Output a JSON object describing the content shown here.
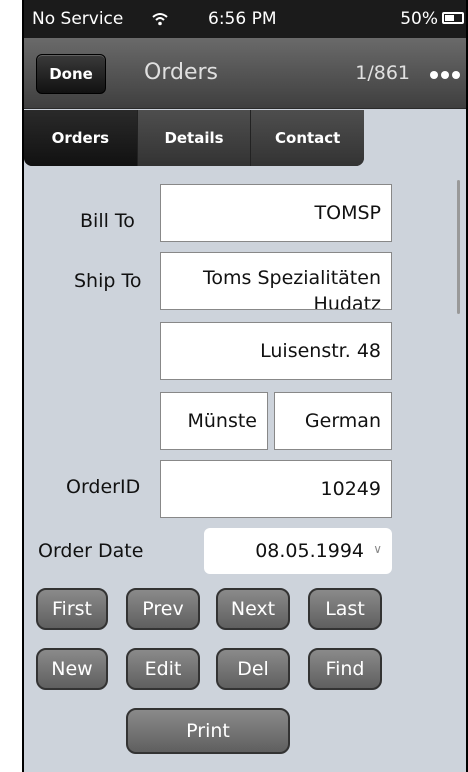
{
  "status": {
    "carrier": "No Service",
    "time": "6:56 PM",
    "battery": "50%"
  },
  "nav": {
    "done": "Done",
    "title": "Orders",
    "record": "1/861"
  },
  "tabs": [
    "Orders",
    "Details",
    "Contact"
  ],
  "form": {
    "bill_to_label": "Bill To",
    "bill_to": "TOMSP",
    "ship_to_label": "Ship To",
    "ship_name": "Toms Spezialitäten",
    "ship_name2": "Hudatz",
    "address": "Luisenstr. 48",
    "city": "Münste",
    "country": "German",
    "orderid_label": "OrderID",
    "orderid": "10249",
    "orderdate_label": "Order Date",
    "orderdate": "08.05.1994"
  },
  "buttons": {
    "first": "First",
    "prev": "Prev",
    "next": "Next",
    "last": "Last",
    "new": "New",
    "edit": "Edit",
    "del": "Del",
    "find": "Find",
    "print": "Print"
  }
}
